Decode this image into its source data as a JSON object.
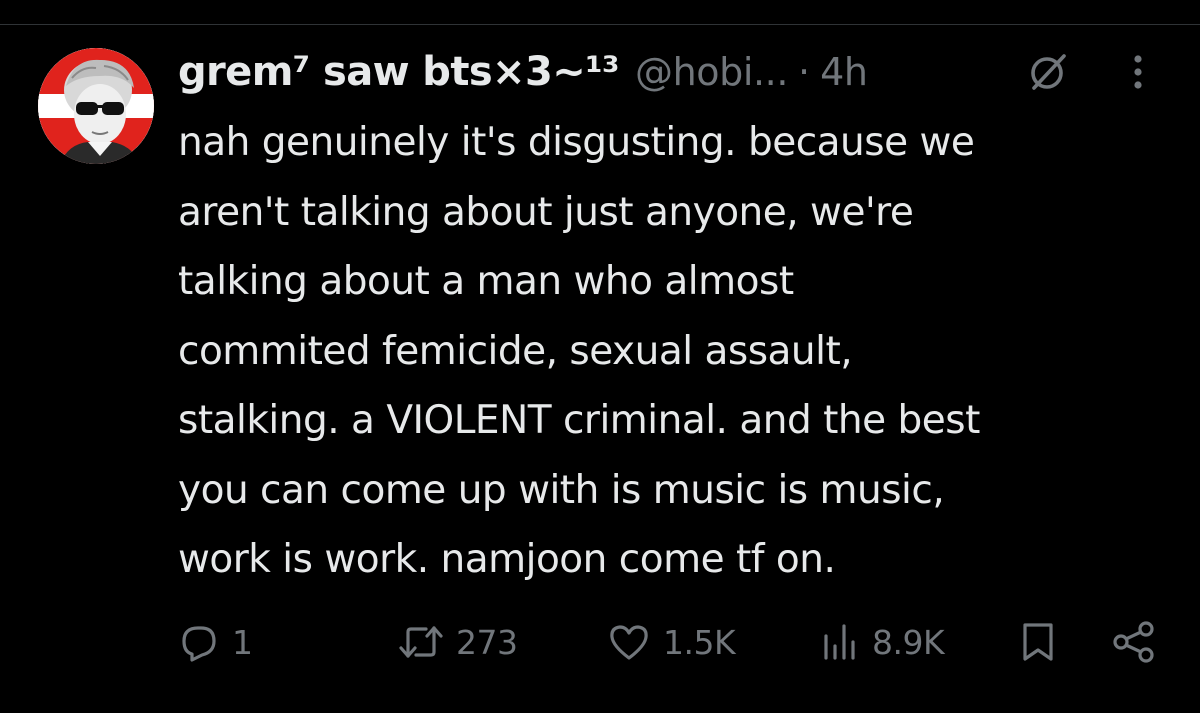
{
  "tweet": {
    "author": {
      "display_name": "grem⁷ saw bts×3~¹³",
      "handle": "@hobi...",
      "separator": "·",
      "time": "4h",
      "avatar_icon": "avatar-photo"
    },
    "text_lines": [
      "nah genuinely it's disgusting. because we",
      "aren't talking about just anyone, we're",
      "talking about a man who almost",
      "commited femicide, sexual assault,",
      "stalking. a VIOLENT criminal. and the best",
      "you can come up with is music is music,",
      "work is work. namjoon come tf on."
    ],
    "actions": {
      "reply_count": "1",
      "retweet_count": "273",
      "like_count": "1.5K",
      "views_count": "8.9K"
    },
    "header_icons": [
      "grok-icon",
      "more-icon"
    ],
    "action_icons": [
      "reply-icon",
      "retweet-icon",
      "like-icon",
      "views-icon",
      "bookmark-icon",
      "share-icon"
    ]
  },
  "colors": {
    "background": "#000000",
    "text_primary": "#e7e9ea",
    "text_secondary": "#71767b",
    "divider": "#2f3336",
    "avatar_accent": "#e0231d"
  }
}
